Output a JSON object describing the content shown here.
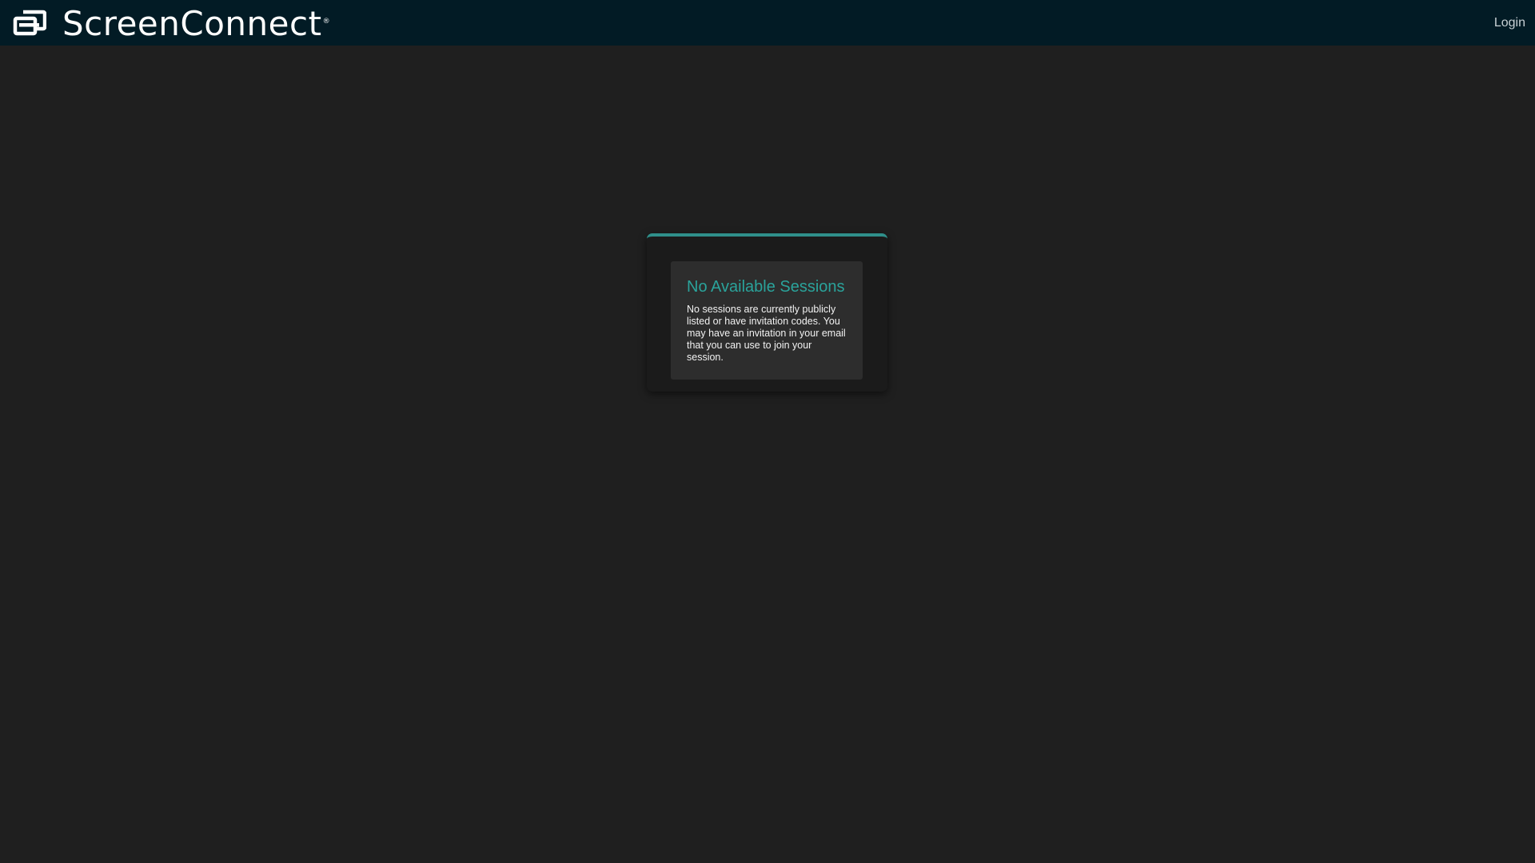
{
  "header": {
    "brand_name": "ScreenConnect",
    "brand_mark": "®",
    "logo_icon": "screenconnect-logo-icon",
    "login_label": "Login",
    "background_color": "#021b25"
  },
  "main": {
    "panel": {
      "accent_color": "#2f8f8a",
      "title": "No Available Sessions",
      "message": "No sessions are currently publicly listed or have invitation codes. You may have an invitation in your email that you can use to join your session."
    }
  }
}
